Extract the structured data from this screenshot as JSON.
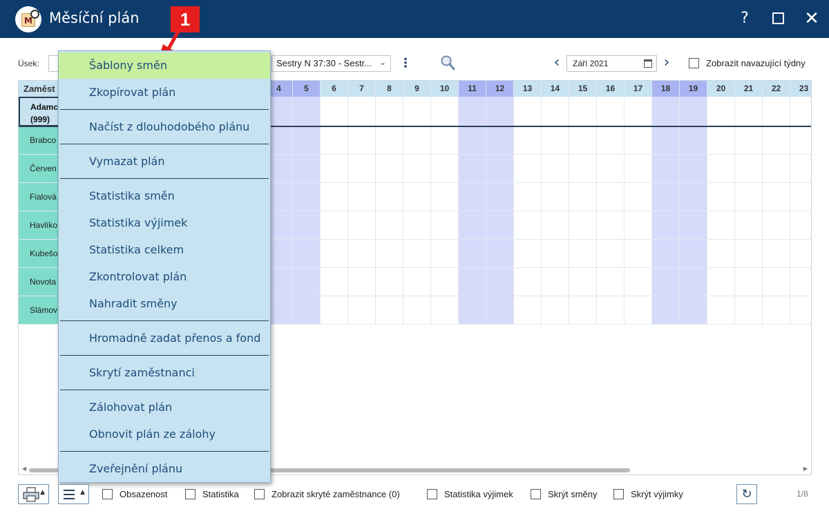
{
  "window": {
    "title": "Měsíční plán",
    "app_icon_letter": "M",
    "help_label": "?",
    "close_label": "✕"
  },
  "annotation": {
    "label": "1"
  },
  "toolbar": {
    "usek_label": "Úsek:",
    "shift_value": "Sestry N 37:30 - Sestr...",
    "month_value": "Září 2021",
    "show_following_weeks_label": "Zobrazit navazující týdny",
    "show_following_weeks_checked": false
  },
  "grid": {
    "employee_column_header": "Zaměst",
    "days": [
      "4",
      "5",
      "6",
      "7",
      "8",
      "9",
      "10",
      "11",
      "12",
      "13",
      "14",
      "15",
      "16",
      "17",
      "18",
      "19",
      "20",
      "21",
      "22",
      "23"
    ],
    "weekend_days": [
      "4",
      "5",
      "11",
      "12",
      "18",
      "19"
    ],
    "first_employee": {
      "name": "Adamc",
      "code": "(999)"
    },
    "employees": [
      "Brabco",
      "Červen",
      "Fialová",
      "Havlíko",
      "Kubešo",
      "Novota",
      "Slámov"
    ]
  },
  "menu": {
    "items": [
      {
        "label": "Šablony směn",
        "active": true
      },
      {
        "label": "Zkopírovat plán"
      },
      {
        "label": "Načíst z dlouhodobého plánu"
      },
      {
        "label": "Vymazat plán"
      },
      {
        "label": "Statistika směn"
      },
      {
        "label": "Statistika výjimek"
      },
      {
        "label": "Statistika celkem"
      },
      {
        "label": "Zkontrolovat plán"
      },
      {
        "label": "Nahradit směny"
      },
      {
        "label": "Hromadně zadat přenos a fond"
      },
      {
        "label": "Skrytí zaměstnanci"
      },
      {
        "label": "Zálohovat plán"
      },
      {
        "label": "Obnovit plán ze zálohy"
      },
      {
        "label": "Zveřejnění plánu"
      }
    ]
  },
  "bottom": {
    "checkboxes": [
      {
        "label": "Obsazenost",
        "checked": false
      },
      {
        "label": "Statistika",
        "checked": false
      },
      {
        "label": "Zobrazit skryté zaměstnance (0)",
        "checked": false
      },
      {
        "label": "Statistika výjimek",
        "checked": false
      },
      {
        "label": "Skrýt směny",
        "checked": false
      },
      {
        "label": "Skrýt výjimky",
        "checked": false
      }
    ],
    "page_count": "1/8"
  },
  "colors": {
    "titlebar": "#0d3b6b",
    "header_bg": "#c7e3f2",
    "weekend": "#d7dbfb",
    "weekend_header": "#a9b4f2",
    "employee_bg": "#7fdccb",
    "menu_bg": "#c7e3f2",
    "menu_active": "#c7ef9e",
    "menu_text": "#1f4c7a",
    "annotation": "#e61e1e"
  }
}
